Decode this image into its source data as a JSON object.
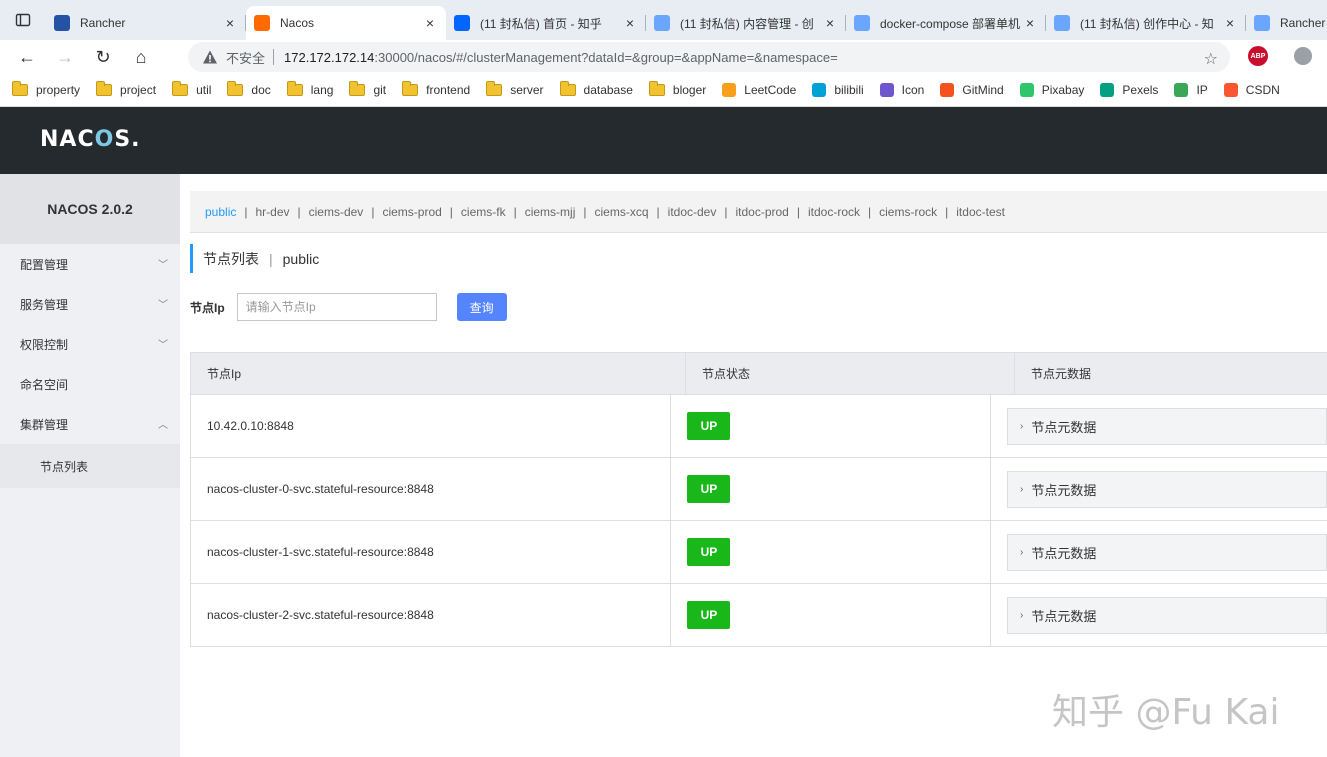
{
  "browser": {
    "tabs": [
      {
        "title": "Rancher",
        "favicon": "rancher-icon",
        "color": "#2453a6",
        "active": false
      },
      {
        "title": "Nacos",
        "favicon": "nacos-icon",
        "color": "#ff6a00",
        "active": true
      },
      {
        "title": "(11 封私信) 首页 - 知乎",
        "favicon": "zhihu-icon",
        "color": "#0066ff",
        "active": false
      },
      {
        "title": "(11 封私信) 内容管理 - 创",
        "favicon": "zhihu-icon",
        "color": "#6aa5ff",
        "active": false
      },
      {
        "title": "docker-compose 部署单机",
        "favicon": "zhihu-icon",
        "color": "#6aa5ff",
        "active": false
      },
      {
        "title": "(11 封私信) 创作中心 - 知",
        "favicon": "zhihu-icon",
        "color": "#6aa5ff",
        "active": false
      },
      {
        "title": "Rancher",
        "favicon": "zhihu-icon",
        "color": "#6aa5ff",
        "active": false
      }
    ],
    "insecure_label": "不安全",
    "url_host": "172.172.172.14",
    "url_rest": ":30000/nacos/#/clusterManagement?dataId=&group=&appName=&namespace=",
    "abp_label": "ABP",
    "bookmarks": [
      {
        "label": "property",
        "type": "folder"
      },
      {
        "label": "project",
        "type": "folder"
      },
      {
        "label": "util",
        "type": "folder"
      },
      {
        "label": "doc",
        "type": "folder"
      },
      {
        "label": "lang",
        "type": "folder"
      },
      {
        "label": "git",
        "type": "folder"
      },
      {
        "label": "frontend",
        "type": "folder"
      },
      {
        "label": "server",
        "type": "folder"
      },
      {
        "label": "database",
        "type": "folder"
      },
      {
        "label": "bloger",
        "type": "folder"
      },
      {
        "label": "LeetCode",
        "type": "site",
        "color": "#f89f1b"
      },
      {
        "label": "bilibili",
        "type": "site",
        "color": "#00a1d6"
      },
      {
        "label": "Icon",
        "type": "site",
        "color": "#6e56cf"
      },
      {
        "label": "GitMind",
        "type": "site",
        "color": "#f4511e"
      },
      {
        "label": "Pixabay",
        "type": "site",
        "color": "#2ec66d"
      },
      {
        "label": "Pexels",
        "type": "site",
        "color": "#05a081"
      },
      {
        "label": "IP",
        "type": "site",
        "color": "#3aa757"
      },
      {
        "label": "CSDN",
        "type": "site",
        "color": "#fc5531"
      }
    ]
  },
  "app": {
    "logo": "NACOS.",
    "version_title": "NACOS 2.0.2",
    "menu": [
      {
        "label": "配置管理",
        "expanded": false
      },
      {
        "label": "服务管理",
        "expanded": false
      },
      {
        "label": "权限控制",
        "expanded": false
      },
      {
        "label": "命名空间",
        "expanded": null
      },
      {
        "label": "集群管理",
        "expanded": true
      }
    ],
    "submenu": [
      "节点列表"
    ]
  },
  "namespaces": [
    "public",
    "hr-dev",
    "ciems-dev",
    "ciems-prod",
    "ciems-fk",
    "ciems-mjj",
    "ciems-xcq",
    "itdoc-dev",
    "itdoc-prod",
    "itdoc-rock",
    "ciems-rock",
    "itdoc-test"
  ],
  "page": {
    "title": "节点列表",
    "namespace": "public",
    "search_label": "节点Ip",
    "search_placeholder": "请输入节点Ip",
    "search_button": "查询"
  },
  "table": {
    "headers": [
      "节点Ip",
      "节点状态",
      "节点元数据"
    ],
    "rows": [
      {
        "ip": "10.42.0.10:8848",
        "status": "UP",
        "meta": "节点元数据"
      },
      {
        "ip": "nacos-cluster-0-svc.stateful-resource:8848",
        "status": "UP",
        "meta": "节点元数据"
      },
      {
        "ip": "nacos-cluster-1-svc.stateful-resource:8848",
        "status": "UP",
        "meta": "节点元数据"
      },
      {
        "ip": "nacos-cluster-2-svc.stateful-resource:8848",
        "status": "UP",
        "meta": "节点元数据"
      }
    ]
  },
  "watermark": "知乎 @Fu Kai",
  "colors": {
    "accent": "#209bfa",
    "button": "#5584ff",
    "status_up": "#1ab71a",
    "header_bg": "#252a2f"
  }
}
